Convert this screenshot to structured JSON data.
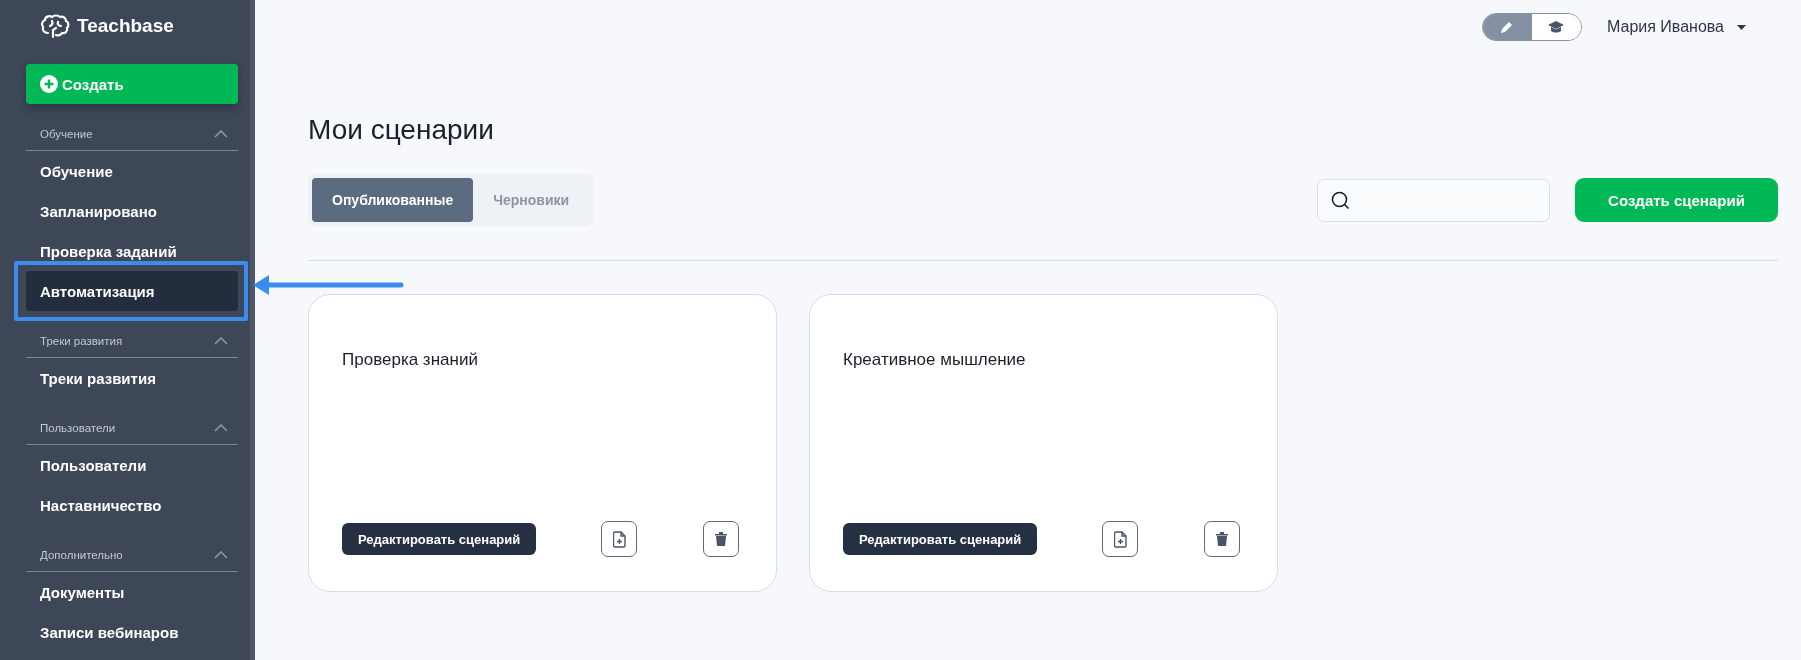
{
  "sidebar": {
    "logo": "Teachbase",
    "create_button": "Создать",
    "sections": [
      {
        "title": "Обучение",
        "expanded": true,
        "items": [
          {
            "label": "Обучение",
            "selected": false,
            "highlighted": false
          },
          {
            "label": "Запланировано",
            "selected": false,
            "highlighted": false
          },
          {
            "label": "Проверка заданий",
            "selected": false,
            "highlighted": false
          },
          {
            "label": "Автоматизация",
            "selected": true,
            "highlighted": true
          }
        ]
      },
      {
        "title": "Треки развития",
        "expanded": true,
        "items": [
          {
            "label": "Треки развития",
            "selected": false,
            "highlighted": false
          }
        ]
      },
      {
        "title": "Пользователи",
        "expanded": true,
        "items": [
          {
            "label": "Пользователи",
            "selected": false,
            "highlighted": false
          },
          {
            "label": "Наставничество",
            "selected": false,
            "highlighted": false
          }
        ]
      },
      {
        "title": "Дополнительно",
        "expanded": true,
        "items": [
          {
            "label": "Документы",
            "selected": false,
            "highlighted": false
          },
          {
            "label": "Записи вебинаров",
            "selected": false,
            "highlighted": false
          }
        ]
      }
    ]
  },
  "topbar": {
    "mode_toggle": [
      {
        "kind": "edit",
        "selected": true
      },
      {
        "kind": "learn",
        "selected": false
      }
    ],
    "user_name": "Мария Иванова"
  },
  "page_title": "Мои сценарии",
  "tabs": [
    {
      "label": "Опубликованные",
      "selected": true
    },
    {
      "label": "Черновики",
      "selected": false
    }
  ],
  "create_scenario_button": "Создать сценарий",
  "cards": [
    {
      "title": "Проверка знаний",
      "edit_button": "Редактировать сценарий"
    },
    {
      "title": "Креативное мышление",
      "edit_button": "Редактировать сценарий"
    }
  ]
}
